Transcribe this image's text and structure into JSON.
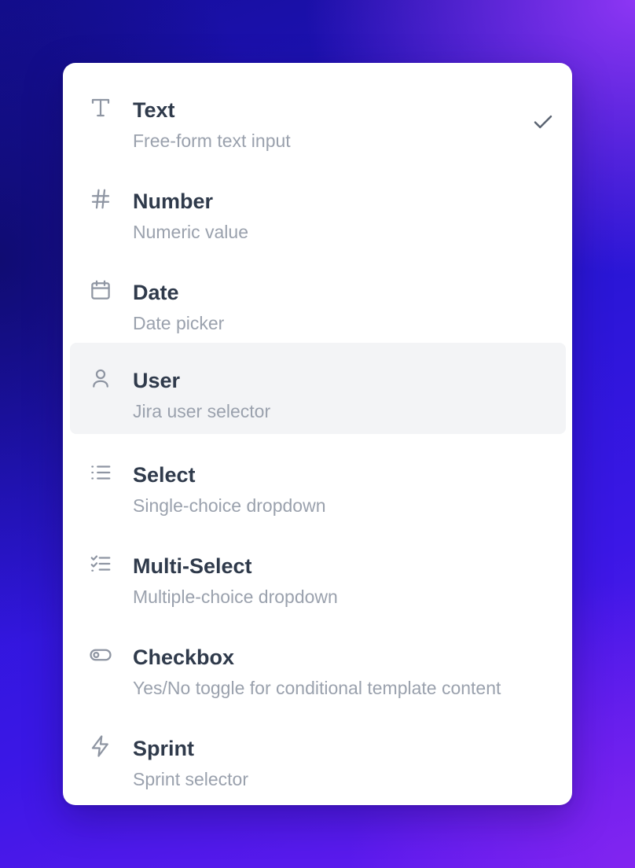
{
  "menu": {
    "items": [
      {
        "label": "Text",
        "description": "Free-form text input",
        "icon": "text-type-icon",
        "selected": true,
        "highlighted": false
      },
      {
        "label": "Number",
        "description": "Numeric value",
        "icon": "hash-icon",
        "selected": false,
        "highlighted": false
      },
      {
        "label": "Date",
        "description": "Date picker",
        "icon": "calendar-icon",
        "selected": false,
        "highlighted": false
      },
      {
        "label": "User",
        "description": "Jira user selector",
        "icon": "user-icon",
        "selected": false,
        "highlighted": true
      },
      {
        "label": "Select",
        "description": "Single-choice dropdown",
        "icon": "list-icon",
        "selected": false,
        "highlighted": false
      },
      {
        "label": "Multi-Select",
        "description": "Multiple-choice dropdown",
        "icon": "list-checks-icon",
        "selected": false,
        "highlighted": false
      },
      {
        "label": "Checkbox",
        "description": "Yes/No toggle for conditional template content",
        "icon": "toggle-icon",
        "selected": false,
        "highlighted": false
      },
      {
        "label": "Sprint",
        "description": "Sprint selector",
        "icon": "zap-icon",
        "selected": false,
        "highlighted": false
      }
    ],
    "selected_indicator_icon": "checkmark-icon"
  },
  "colors": {
    "label": "#2f3a4b",
    "description": "#9aa1ad",
    "icon": "#8e95a2",
    "highlight_bg": "#f3f4f6"
  }
}
